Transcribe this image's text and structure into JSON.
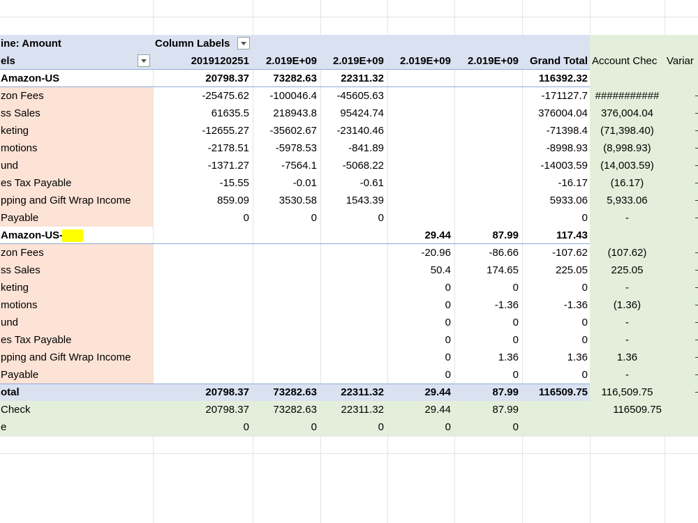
{
  "pivot": {
    "header1": {
      "row_label": "ine: Amount",
      "col_labels": "Column Labels"
    },
    "header2": {
      "row_label": "els",
      "cols": [
        "2019120251",
        "2.019E+09",
        "2.019E+09",
        "2.019E+09",
        "2.019E+09",
        "Grand Total"
      ],
      "extra1": "Account Chec",
      "extra2": "Variar"
    },
    "rows": [
      {
        "kind": "group",
        "label": "Amazon-US",
        "vals": [
          "20798.37",
          "73282.63",
          "22311.32",
          "",
          "",
          "116392.32"
        ],
        "e1": "",
        "e2": ""
      },
      {
        "kind": "item",
        "label": "zon Fees",
        "vals": [
          "-25475.62",
          "-100046.4",
          "-45605.63",
          "",
          "",
          "-171127.7"
        ],
        "e1": "###########",
        "e2": ""
      },
      {
        "kind": "item",
        "label": "ss Sales",
        "vals": [
          "61635.5",
          "218943.8",
          "95424.74",
          "",
          "",
          "376004.04"
        ],
        "e1": "376,004.04",
        "e2": ""
      },
      {
        "kind": "item",
        "label": "keting",
        "vals": [
          "-12655.27",
          "-35602.67",
          "-23140.46",
          "",
          "",
          "-71398.4"
        ],
        "e1": "(71,398.40)",
        "e2": ""
      },
      {
        "kind": "item",
        "label": "motions",
        "vals": [
          "-2178.51",
          "-5978.53",
          "-841.89",
          "",
          "",
          "-8998.93"
        ],
        "e1": "(8,998.93)",
        "e2": ""
      },
      {
        "kind": "item",
        "label": "und",
        "vals": [
          "-1371.27",
          "-7564.1",
          "-5068.22",
          "",
          "",
          "-14003.59"
        ],
        "e1": "(14,003.59)",
        "e2": ""
      },
      {
        "kind": "item",
        "label": "es Tax Payable",
        "vals": [
          "-15.55",
          "-0.01",
          "-0.61",
          "",
          "",
          "-16.17"
        ],
        "e1": "(16.17)",
        "e2": ""
      },
      {
        "kind": "item",
        "label": "pping and Gift Wrap Income",
        "vals": [
          "859.09",
          "3530.58",
          "1543.39",
          "",
          "",
          "5933.06"
        ],
        "e1": "5,933.06",
        "e2": ""
      },
      {
        "kind": "item",
        "label": "Payable",
        "vals": [
          "0",
          "0",
          "0",
          "",
          "",
          "0"
        ],
        "e1": "-",
        "e2": ""
      },
      {
        "kind": "group",
        "label": "Amazon-US-",
        "vals": [
          "",
          "",
          "",
          "29.44",
          "87.99",
          "117.43"
        ],
        "e1": "",
        "e2": ""
      },
      {
        "kind": "item",
        "label": "zon Fees",
        "vals": [
          "",
          "",
          "",
          "-20.96",
          "-86.66",
          "-107.62"
        ],
        "e1": "(107.62)",
        "e2": ""
      },
      {
        "kind": "item",
        "label": "ss Sales",
        "vals": [
          "",
          "",
          "",
          "50.4",
          "174.65",
          "225.05"
        ],
        "e1": "225.05",
        "e2": ""
      },
      {
        "kind": "item",
        "label": "keting",
        "vals": [
          "",
          "",
          "",
          "0",
          "0",
          "0"
        ],
        "e1": "-",
        "e2": ""
      },
      {
        "kind": "item",
        "label": "motions",
        "vals": [
          "",
          "",
          "",
          "0",
          "-1.36",
          "-1.36"
        ],
        "e1": "(1.36)",
        "e2": ""
      },
      {
        "kind": "item",
        "label": "und",
        "vals": [
          "",
          "",
          "",
          "0",
          "0",
          "0"
        ],
        "e1": "-",
        "e2": ""
      },
      {
        "kind": "item",
        "label": "es Tax Payable",
        "vals": [
          "",
          "",
          "",
          "0",
          "0",
          "0"
        ],
        "e1": "-",
        "e2": ""
      },
      {
        "kind": "item",
        "label": "pping and Gift Wrap Income",
        "vals": [
          "",
          "",
          "",
          "0",
          "1.36",
          "1.36"
        ],
        "e1": "1.36",
        "e2": ""
      },
      {
        "kind": "item",
        "label": "Payable",
        "vals": [
          "",
          "",
          "",
          "0",
          "0",
          "0"
        ],
        "e1": "-",
        "e2": ""
      },
      {
        "kind": "total",
        "label": "otal",
        "vals": [
          "20798.37",
          "73282.63",
          "22311.32",
          "29.44",
          "87.99",
          "116509.75"
        ],
        "e1": "116,509.75",
        "e2": ""
      },
      {
        "kind": "check",
        "label": "Check",
        "vals": [
          "20798.37",
          "73282.63",
          "22311.32",
          "29.44",
          "87.99",
          ""
        ],
        "e1": "116509.75",
        "e2": ""
      },
      {
        "kind": "check",
        "label": "e",
        "vals": [
          "0",
          "0",
          "0",
          "0",
          "0",
          ""
        ],
        "e1": "",
        "e2": ""
      }
    ]
  },
  "colors": {
    "header_blue": "#dae2f2",
    "row_label_peach": "#fce3d6",
    "extra_green": "#e3efda",
    "divider_blue": "#8ea9db",
    "highlight_yellow": "#ffff00"
  },
  "icons": {
    "col_filter": "dropdown-arrow-icon",
    "row_filter": "dropdown-arrow-icon"
  }
}
